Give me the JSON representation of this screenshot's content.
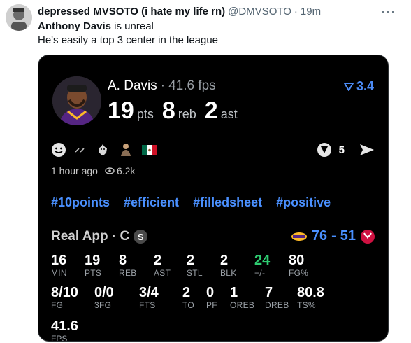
{
  "tweet": {
    "display_name": "depressed MVSOTO (i hate my life rn)",
    "handle": "@DMVSOTO",
    "dot": "·",
    "time": "19m",
    "more": "···",
    "line1_bold": "Anthony Davis",
    "line1_rest": " is unreal",
    "line2": "He's easily a top 3 center in the league"
  },
  "card": {
    "player_name": "A. Davis",
    "sep": "·",
    "fps": "41.6 fps",
    "boost_value": "3.4",
    "pts": "19",
    "pts_unit": "pts",
    "reb": "8",
    "reb_unit": "reb",
    "ast": "2",
    "ast_unit": "ast",
    "reaction_count": "5",
    "posted": "1 hour ago",
    "views": "6.2k",
    "tags": [
      "#10points",
      "#efficient",
      "#filledsheet",
      "#positive"
    ],
    "app_label": "Real App · C",
    "s_badge": "S",
    "score_home": "76",
    "score_sep": "-",
    "score_away": "51",
    "row1": [
      {
        "v": "16",
        "l": "MIN"
      },
      {
        "v": "19",
        "l": "PTS"
      },
      {
        "v": "8",
        "l": "REB"
      },
      {
        "v": "2",
        "l": "AST"
      },
      {
        "v": "2",
        "l": "STL"
      },
      {
        "v": "2",
        "l": "BLK"
      },
      {
        "v": "24",
        "l": "+/-"
      },
      {
        "v": "80",
        "l": "FG%"
      }
    ],
    "row2": [
      {
        "v": "8/10",
        "l": "FG"
      },
      {
        "v": "0/0",
        "l": "3FG"
      },
      {
        "v": "3/4",
        "l": "FTS"
      },
      {
        "v": "2",
        "l": "TO"
      },
      {
        "v": "0",
        "l": "PF"
      },
      {
        "v": "1",
        "l": "OREB"
      },
      {
        "v": "7",
        "l": "DREB"
      },
      {
        "v": "80.8",
        "l": "TS%"
      }
    ],
    "fps_value": "41.6",
    "fps_label": "FPS"
  },
  "colors": {
    "link_blue": "#4a90ff",
    "plus_minus_green": "#2ecc71",
    "card_bg": "#000000"
  },
  "icons": [
    "user-avatar",
    "player-photo",
    "boost-icon",
    "smile-icon",
    "goat-icon",
    "person-icon",
    "mexico-flag-icon",
    "reaction-icon",
    "share-icon",
    "eye-icon",
    "lakers-logo",
    "raptors-logo"
  ]
}
